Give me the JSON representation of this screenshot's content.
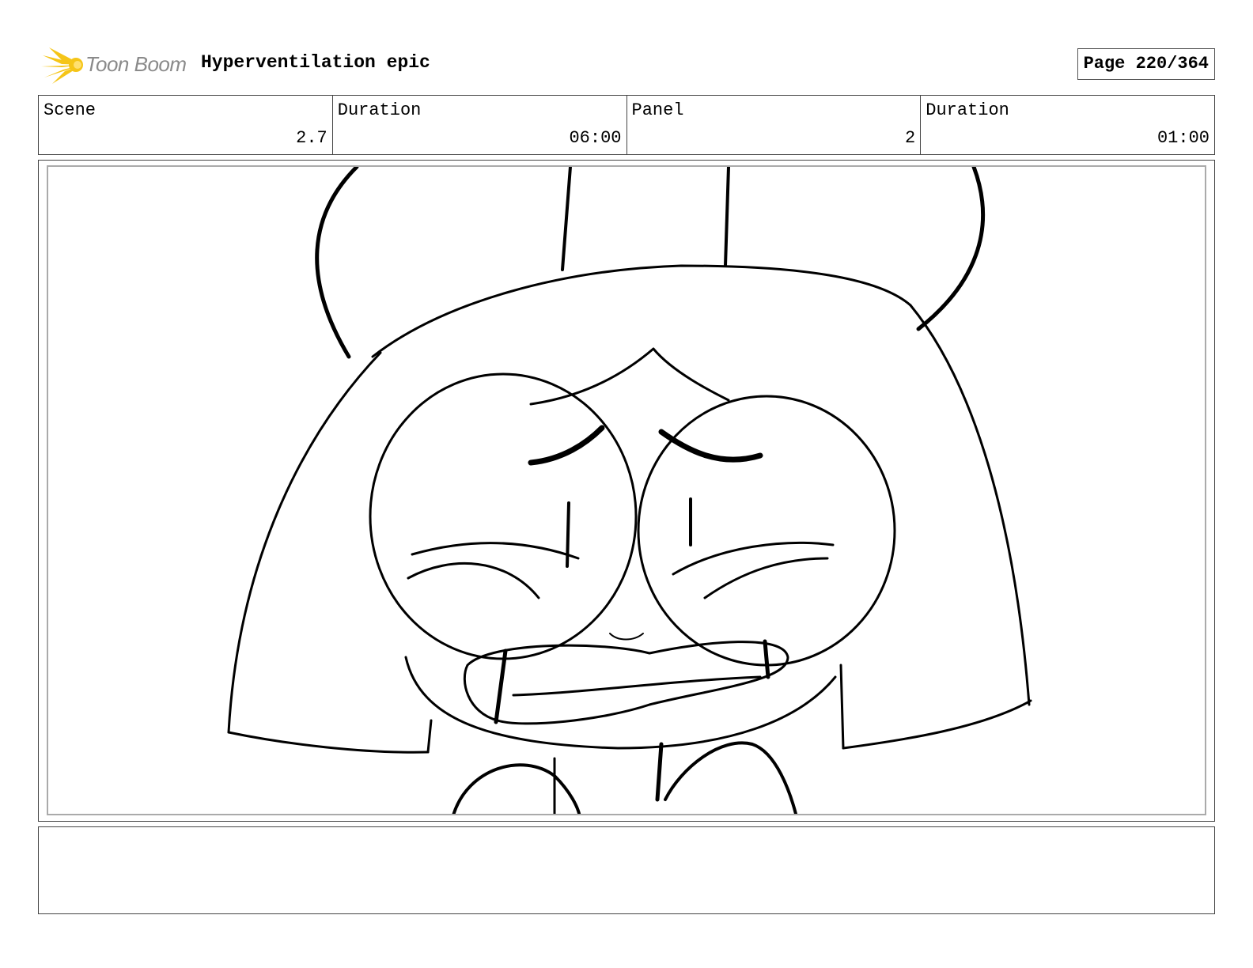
{
  "header": {
    "logo_text": "Toon Boom",
    "logo_icon": "toon-boom-star-logo",
    "project_title": "Hyperventilation epic",
    "page_label": "Page 220/364"
  },
  "info": {
    "scene_label": "Scene",
    "scene_value": "2.7",
    "scene_duration_label": "Duration",
    "scene_duration_value": "06:00",
    "panel_label": "Panel",
    "panel_value": "2",
    "panel_duration_label": "Duration",
    "panel_duration_value": "01:00"
  },
  "panel_image": {
    "description_icon": "storyboard-sketch-crying-girl"
  },
  "notes": {
    "text": ""
  },
  "colors": {
    "logo_accent": "#f5c518",
    "logo_text": "#8a8a8a",
    "border": "#444444",
    "frame_inner": "#aaaaaa"
  }
}
